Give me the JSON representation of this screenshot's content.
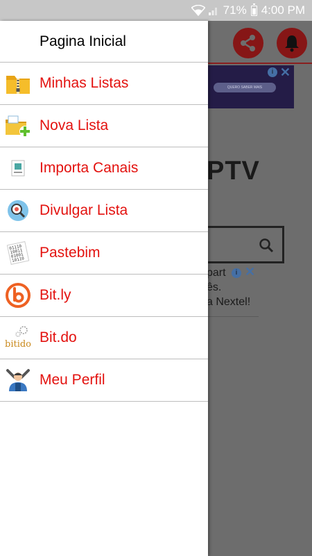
{
  "status_bar": {
    "battery": "71%",
    "time": "4:00 PM"
  },
  "drawer": {
    "header": "Pagina Inicial",
    "items": [
      {
        "label": "Minhas Listas",
        "icon": "folder-zip-icon"
      },
      {
        "label": "Nova Lista",
        "icon": "folder-add-icon"
      },
      {
        "label": "Importa Canais",
        "icon": "import-file-icon"
      },
      {
        "label": "Divulgar Lista",
        "icon": "magnifier-icon"
      },
      {
        "label": "Pastebim",
        "icon": "binary-paper-icon"
      },
      {
        "label": "Bit.ly",
        "icon": "bitly-logo-icon"
      },
      {
        "label": "Bit.do",
        "icon": "bitdo-logo-icon"
      },
      {
        "label": "Meu Perfil",
        "icon": "mechanic-profile-icon"
      }
    ]
  },
  "background": {
    "logo_fragment": "PTV",
    "ad_button": "QUERO SABER MAIS",
    "ad_text": [
      "part",
      "ês.",
      "a Nextel!"
    ]
  },
  "colors": {
    "accent": "#e3120f",
    "status_bar": "#c7c7c7"
  }
}
